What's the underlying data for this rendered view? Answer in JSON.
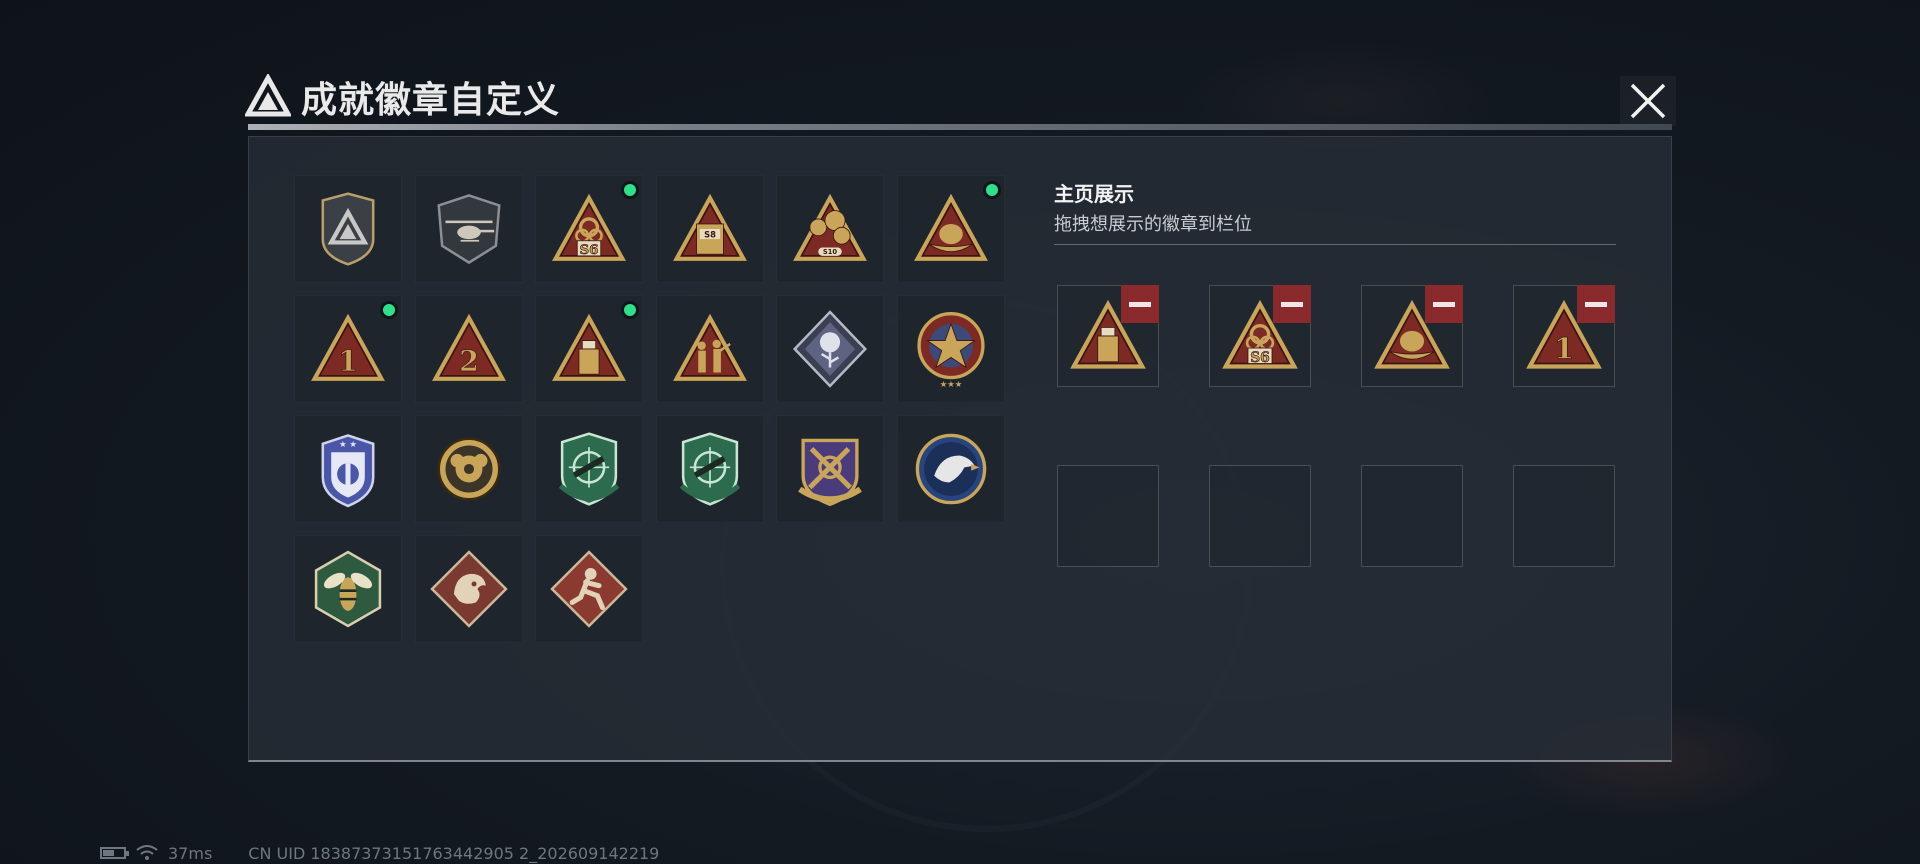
{
  "header": {
    "title": "成就徽章自定义",
    "logo_icon": "triangle-emblem-icon",
    "close_icon": "close-icon"
  },
  "colors": {
    "new_indicator": "#2fe08a",
    "remove_button": "#8b2a2c",
    "badge_gold": "#c9a55a",
    "badge_red": "#7d2a25"
  },
  "badges": [
    {
      "icon": "silver-triangle-shield-badge-icon",
      "new": false
    },
    {
      "icon": "helicopter-shield-badge-icon",
      "new": false
    },
    {
      "icon": "biohazard-s6-triangle-badge-icon",
      "new": true,
      "label": "S6"
    },
    {
      "icon": "s8-box-triangle-badge-icon",
      "new": false,
      "label": "S8"
    },
    {
      "icon": "flower-s10-triangle-badge-icon",
      "new": false,
      "label": "S10"
    },
    {
      "icon": "nest-egg-triangle-badge-icon",
      "new": true
    },
    {
      "icon": "number-one-triangle-badge-icon",
      "new": true,
      "label": "1"
    },
    {
      "icon": "number-two-triangle-badge-icon",
      "new": false,
      "label": "2"
    },
    {
      "icon": "usb-drive-triangle-badge-icon",
      "new": true
    },
    {
      "icon": "soldiers-triangle-badge-icon",
      "new": false
    },
    {
      "icon": "silver-rose-diamond-badge-icon",
      "new": false
    },
    {
      "icon": "star-medal-round-badge-icon",
      "new": false
    },
    {
      "icon": "blue-shield-star-badge-icon",
      "new": false
    },
    {
      "icon": "bronze-gear-round-badge-icon",
      "new": false
    },
    {
      "icon": "green-rifle-shield-badge-icon",
      "new": false
    },
    {
      "icon": "green-rifle-shield-badge-alt-icon",
      "new": false
    },
    {
      "icon": "crossed-swords-purple-badge-icon",
      "new": false
    },
    {
      "icon": "eagle-round-badge-icon",
      "new": false
    },
    {
      "icon": "wasp-hexagon-badge-icon",
      "new": false
    },
    {
      "icon": "dragon-diamond-badge-icon",
      "new": false
    },
    {
      "icon": "runner-diamond-badge-icon",
      "new": false
    }
  ],
  "showcase": {
    "title": "主页展示",
    "subtitle": "拖拽想展示的徽章到栏位",
    "slots": [
      {
        "icon": "usb-drive-triangle-badge-icon",
        "filled": true
      },
      {
        "icon": "biohazard-s6-triangle-badge-icon",
        "filled": true,
        "label": "S6"
      },
      {
        "icon": "nest-egg-triangle-badge-icon",
        "filled": true
      },
      {
        "icon": "number-one-triangle-badge-icon",
        "filled": true,
        "label": "1"
      },
      {
        "filled": false
      },
      {
        "filled": false
      },
      {
        "filled": false
      },
      {
        "filled": false
      }
    ],
    "remove_icon": "minus-icon"
  },
  "status": {
    "battery_level": 0.55,
    "ping": "37ms",
    "uid": "CN UID 18387373151763442905 2_202609142219"
  }
}
